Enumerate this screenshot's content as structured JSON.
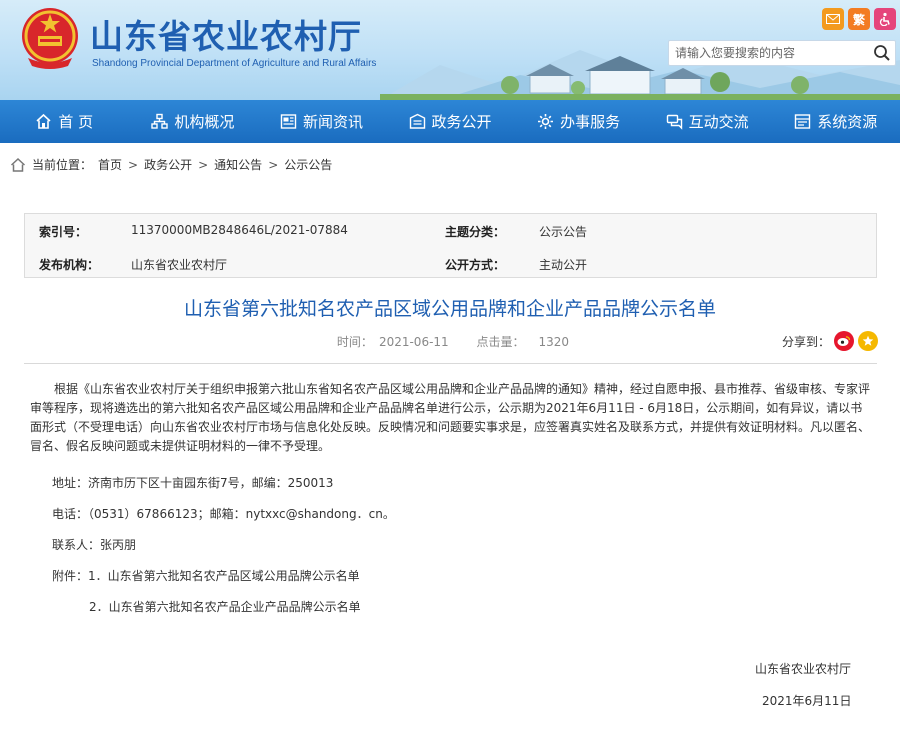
{
  "header": {
    "title": "山东省农业农村厅",
    "subtitle": "Shandong Provincial Department of Agriculture and Rural Affairs",
    "search_placeholder": "请输入您要搜索的内容",
    "traditional_label": "繁",
    "icons": [
      "mail-icon",
      "weibo-icon",
      "accessibility-icon",
      "search-icon"
    ]
  },
  "nav": {
    "items": [
      {
        "label": "首 页",
        "icon": "home-icon"
      },
      {
        "label": "机构概况",
        "icon": "org-icon"
      },
      {
        "label": "新闻资讯",
        "icon": "news-icon"
      },
      {
        "label": "政务公开",
        "icon": "gov-icon"
      },
      {
        "label": "办事服务",
        "icon": "service-icon"
      },
      {
        "label": "互动交流",
        "icon": "chat-icon"
      },
      {
        "label": "系统资源",
        "icon": "resource-icon"
      }
    ]
  },
  "breadcrumb": {
    "prefix": "当前位置：",
    "items": [
      "首页",
      "政务公开",
      "通知公告",
      "公示公告"
    ],
    "separator": ">"
  },
  "info": {
    "index_label": "索引号：",
    "index_value": "11370000MB2848646L/2021-07884",
    "topic_label": "主题分类：",
    "topic_value": "公示公告",
    "org_label": "发布机构：",
    "org_value": "山东省农业农村厅",
    "mode_label": "公开方式：",
    "mode_value": "主动公开"
  },
  "article": {
    "title": "山东省第六批知名农产品区域公用品牌和企业产品品牌公示名单",
    "time_label": "时间：",
    "time_value": "2021-06-11",
    "clicks_label": "点击量：",
    "clicks_value": "1320",
    "share_label": "分享到：",
    "body": "根据《山东省农业农村厅关于组织申报第六批山东省知名农产品区域公用品牌和企业产品品牌的通知》精神，经过自愿申报、县市推荐、省级审核、专家评审等程序，现将遴选出的第六批知名农产品区域公用品牌和企业产品品牌名单进行公示，公示期为2021年6月11日 - 6月18日，公示期间，如有异议，请以书面形式（不受理电话）向山东省农业农村厅市场与信息化处反映。反映情况和问题要实事求是，应签署真实姓名及联系方式，并提供有效证明材料。凡以匿名、冒名、假名反映问题或未提供证明材料的一律不予受理。",
    "address": "地址：济南市历下区十亩园东街7号，邮编：250013",
    "phone": "电话：（0531）67866123；邮箱：nytxxc@shandong．cn。",
    "contact": "联系人：张丙朋",
    "attachment_1": "附件：1．山东省第六批知名农产品区域公用品牌公示名单",
    "attachment_2": "2．山东省第六批知名农产品企业产品品牌公示名单",
    "signature": "山东省农业农村厅",
    "date": "2021年6月11日"
  },
  "colors": {
    "brand_blue": "#1f5fb1",
    "nav_blue": "#1a6cbf",
    "weibo_red": "#e6162d",
    "share_yellow": "#f5b800"
  }
}
